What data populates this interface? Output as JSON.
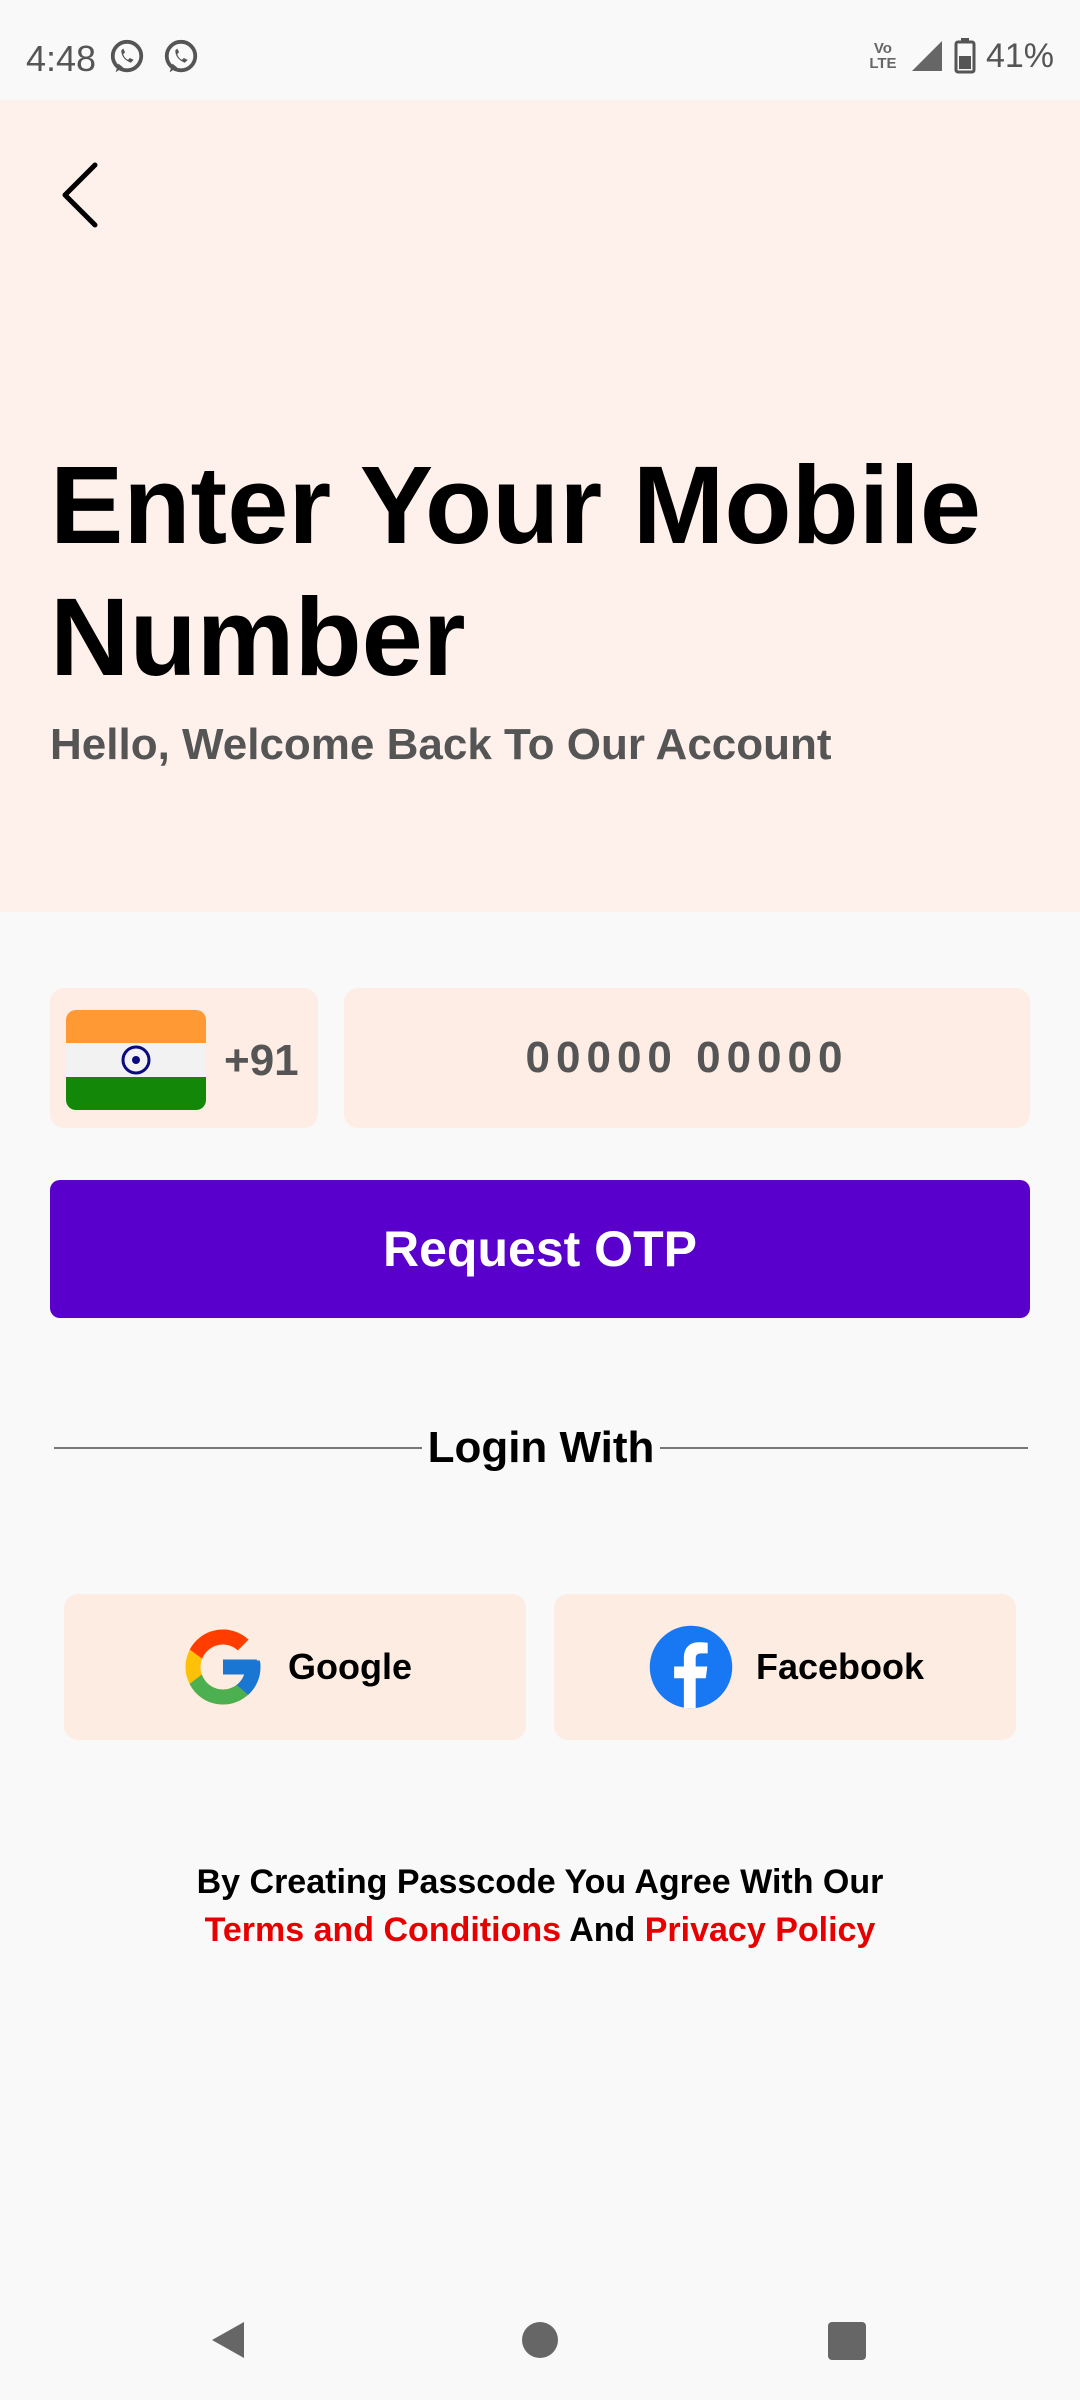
{
  "status_bar": {
    "time": "4:48",
    "network": "Vo LTE",
    "battery": "41%",
    "icons": [
      "whatsapp-icon",
      "whatsapp-icon",
      "signal-icon",
      "battery-icon"
    ]
  },
  "header": {
    "back_icon": "chevron-left-icon",
    "title": "Enter Your Mobile Number",
    "subtitle": "Hello, Welcome Back To Our Account",
    "background": "#fef1eb"
  },
  "phone": {
    "country_flag": "india-flag",
    "dial_code": "+91",
    "placeholder": "00000 00000"
  },
  "request_button": {
    "label": "Request OTP",
    "color": "#5a00cc"
  },
  "divider": {
    "label": "Login With"
  },
  "social": {
    "google_label": "Google",
    "facebook_label": "Facebook"
  },
  "terms": {
    "line1": "By Creating Passcode You Agree With Our",
    "terms_link": "Terms and Conditions",
    "and": "And",
    "privacy_link": "Privacy Policy",
    "link_color": "#e60000"
  },
  "nav": {
    "icons": [
      "nav-back-icon",
      "nav-home-icon",
      "nav-recent-icon"
    ]
  }
}
